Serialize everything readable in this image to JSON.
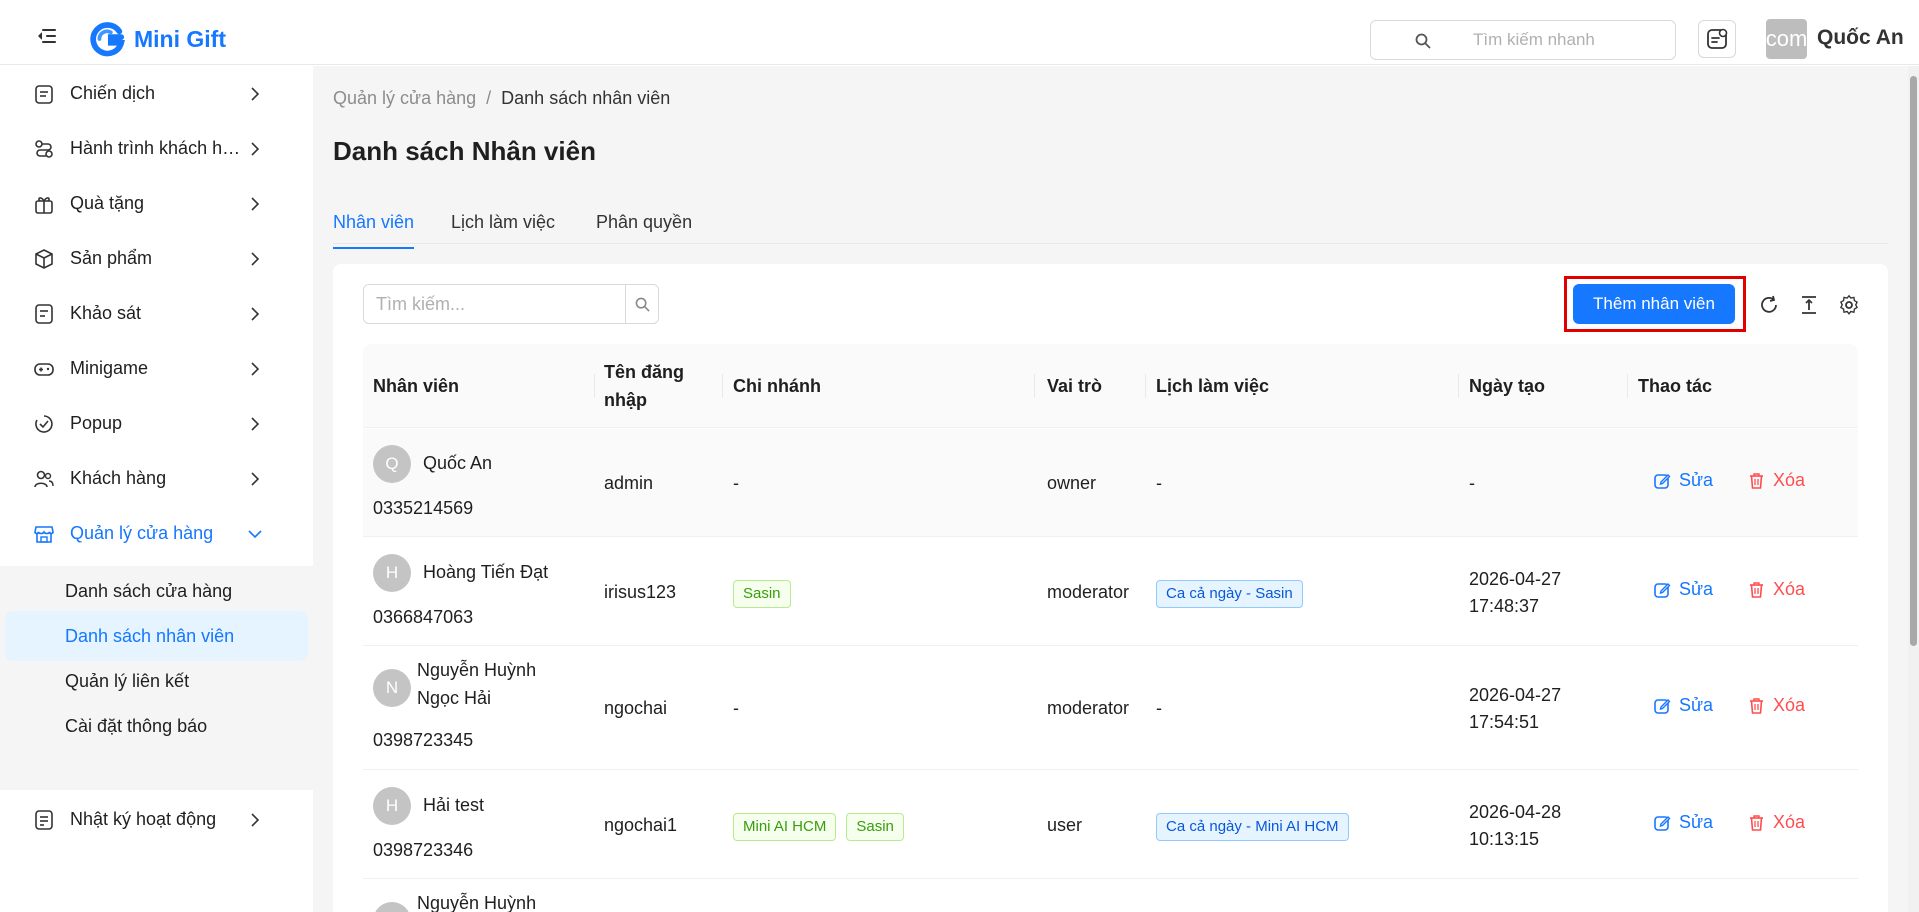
{
  "app": {
    "name": "Mini Gift",
    "brand_color": "#1677ff"
  },
  "header": {
    "search_placeholder": "Tìm kiếm nhanh",
    "avatar_text": "com",
    "user_name": "Quốc An"
  },
  "sidebar": {
    "items": [
      {
        "label": "Chiến dịch",
        "icon": "campaign-icon"
      },
      {
        "label": "Hành trình khách hàng",
        "icon": "journey-icon"
      },
      {
        "label": "Quà tặng",
        "icon": "gift-icon"
      },
      {
        "label": "Sản phẩm",
        "icon": "box-icon"
      },
      {
        "label": "Khảo sát",
        "icon": "survey-icon"
      },
      {
        "label": "Minigame",
        "icon": "gamepad-icon"
      },
      {
        "label": "Popup",
        "icon": "popup-icon"
      },
      {
        "label": "Khách hàng",
        "icon": "users-icon"
      },
      {
        "label": "Quản lý cửa hàng",
        "icon": "store-icon"
      },
      {
        "label": "Nhật ký hoạt động",
        "icon": "log-icon"
      }
    ],
    "submenu": [
      {
        "label": "Danh sách cửa hàng"
      },
      {
        "label": "Danh sách nhân viên"
      },
      {
        "label": "Quản lý liên kết"
      },
      {
        "label": "Cài đặt thông báo"
      }
    ]
  },
  "breadcrumb": {
    "parent": "Quản lý cửa hàng",
    "separator": "/",
    "current": "Danh sách nhân viên"
  },
  "page_title": "Danh sách Nhân viên",
  "tabs": [
    {
      "label": "Nhân viên"
    },
    {
      "label": "Lịch làm việc"
    },
    {
      "label": "Phân quyền"
    }
  ],
  "toolbar": {
    "search_placeholder": "Tìm kiếm...",
    "add_label": "Thêm nhân viên"
  },
  "table": {
    "columns": {
      "employee": "Nhân viên",
      "username": "Tên đăng nhập",
      "branch": "Chi nhánh",
      "role": "Vai trò",
      "schedule": "Lịch làm việc",
      "created": "Ngày tạo",
      "actions": "Thao tác"
    },
    "edit_label": "Sửa",
    "delete_label": "Xóa",
    "rows": [
      {
        "initial": "Q",
        "name": "Quốc An",
        "phone": "0335214569",
        "username": "admin",
        "branch": "-",
        "role": "owner",
        "schedule": "-",
        "created_date": "-",
        "created_time": ""
      },
      {
        "initial": "H",
        "name": "Hoàng Tiến Đạt",
        "phone": "0366847063",
        "username": "irisus123",
        "branch_tags": [
          "Sasin"
        ],
        "role": "moderator",
        "schedule_tag": "Ca cả ngày - Sasin",
        "created_date": "2026-04-27",
        "created_time": "17:48:37"
      },
      {
        "initial": "N",
        "name_line1": "Nguyễn Huỳnh",
        "name_line2": "Ngọc Hải",
        "phone": "0398723345",
        "username": "ngochai",
        "branch": "-",
        "role": "moderator",
        "schedule": "-",
        "created_date": "2026-04-27",
        "created_time": "17:54:51"
      },
      {
        "initial": "H",
        "name": "Hải test",
        "phone": "0398723346",
        "username": "ngochai1",
        "branch_tags": [
          "Mini AI HCM",
          "Sasin"
        ],
        "role": "user",
        "schedule_tag": "Ca cả ngày - Mini AI HCM",
        "created_date": "2026-04-28",
        "created_time": "10:13:15"
      },
      {
        "initial": "N",
        "name_line1": "Nguyễn Huỳnh"
      }
    ]
  }
}
